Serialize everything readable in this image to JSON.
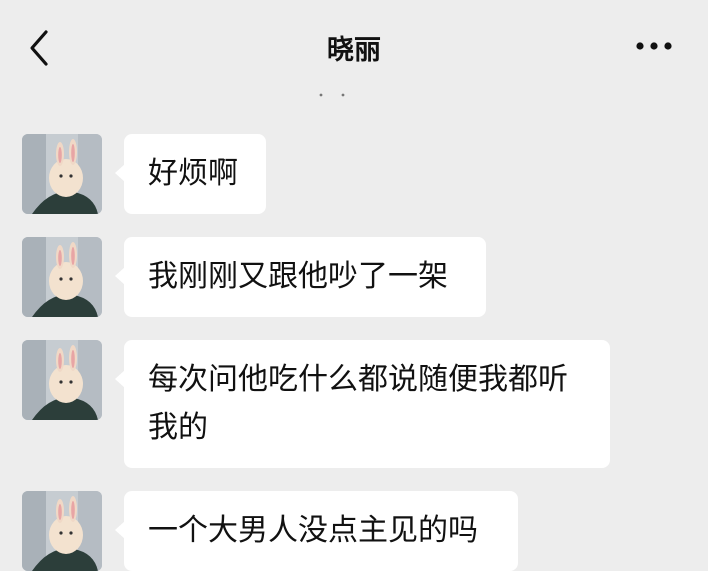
{
  "header": {
    "title": "晓丽",
    "back_icon": "chevron-left-icon",
    "more_icon": "more-dots-icon"
  },
  "messages": [
    {
      "text": "好烦啊"
    },
    {
      "text": "我刚刚又跟他吵了一架"
    },
    {
      "text": "每次问他吃什么都说随便我都听我的"
    },
    {
      "text": "一个大男人没点主见的吗"
    }
  ],
  "colors": {
    "background": "#ededed",
    "bubble": "#ffffff",
    "text": "#111111"
  }
}
